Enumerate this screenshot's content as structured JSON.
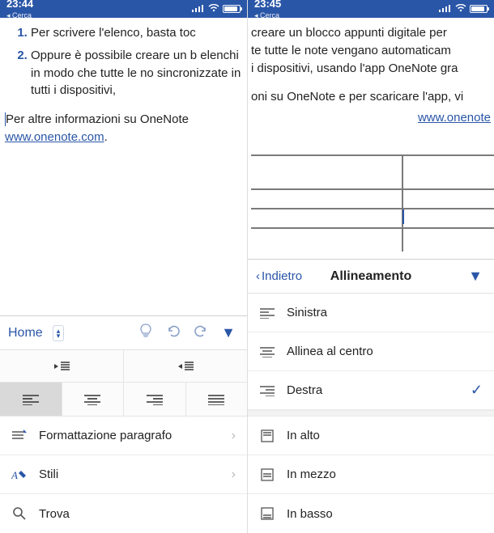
{
  "left": {
    "status": {
      "time": "23:44",
      "back": "Cerca"
    },
    "doc": {
      "item1": "Per scrivere l'elenco, basta toc",
      "item2": "Oppure è possibile creare un b elenchi in modo che tutte le no sincronizzate in tutti i dispositivi,",
      "info_prefix": "er altre informazioni su OneNote ",
      "link": "www.onenote.com",
      "period": "."
    },
    "panel": {
      "home": "Home",
      "rows": {
        "formattazione": "Formattazione paragrafo",
        "stili": "Stili",
        "trova": "Trova"
      }
    }
  },
  "right": {
    "status": {
      "time": "23:45",
      "back": "Cerca"
    },
    "doc": {
      "l1": "creare un blocco appunti digitale per",
      "l2": "te tutte le note vengano automaticam",
      "l3": "i dispositivi, usando l'app OneNote gra",
      "p2": "oni su OneNote e per scaricare l'app, vi",
      "link": "www.onenote"
    },
    "panel": {
      "back": "Indietro",
      "title": "Allineamento",
      "rows": {
        "sinistra": "Sinistra",
        "centro": "Allinea al centro",
        "destra": "Destra",
        "alto": "In alto",
        "mezzo": "In mezzo",
        "basso": "In basso"
      }
    }
  }
}
